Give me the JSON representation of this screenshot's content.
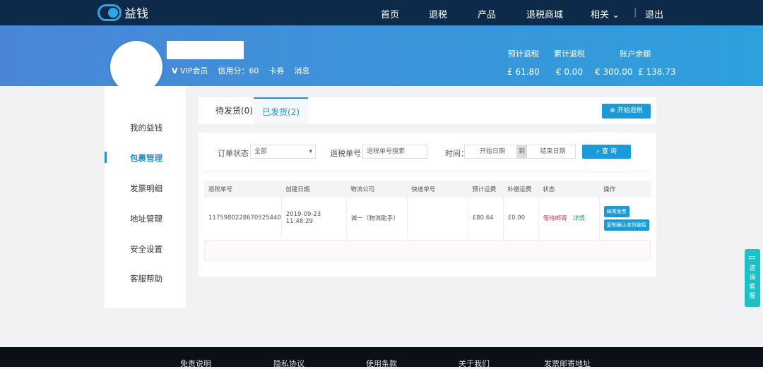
{
  "nav": {
    "brand": "益钱",
    "items": [
      "首页",
      "退税",
      "产品",
      "退税商城",
      "相关"
    ],
    "logout": "退出"
  },
  "profile": {
    "vip": "VIP会员",
    "credit": "信用分：60",
    "coupons": "卡券",
    "messages": "消息"
  },
  "stats": [
    {
      "label": "预计退税",
      "value": "£ 61.80"
    },
    {
      "label": "累计退税",
      "value": "€ 0.00"
    },
    {
      "label": "账户余额",
      "value": "€ 300.00  £ 138.73"
    }
  ],
  "sidebar": [
    "我的益钱",
    "包裹管理",
    "发票明细",
    "地址管理",
    "安全设置",
    "客服帮助"
  ],
  "tabs": [
    "待发货(0)",
    "已发货(2)"
  ],
  "start_button": "⊕ 开始退税",
  "filters": {
    "status_label": "订单状态：",
    "status_value": "全部",
    "order_label": "退税单号：",
    "order_placeholder": "退税单号搜索",
    "time_label": "时间：",
    "start_placeholder": "开始日期",
    "to": "到",
    "end_placeholder": "结束日期",
    "search": "查 询"
  },
  "table": {
    "headers": [
      "退税单号",
      "创建日期",
      "物流公司",
      "快递单号",
      "预计运费",
      "补缴运费",
      "状态",
      "操作"
    ],
    "rows": [
      {
        "id": "1175980228670525440",
        "date": "2019-09-23 11:48:29",
        "carrier": "诚一（物流助手）",
        "tracking": "",
        "est": "£80.64",
        "extra": "£0.00",
        "status": "等待邮寄",
        "detail": "详情",
        "action1": "邮寄发票",
        "action2": "复制确认收货链接"
      }
    ]
  },
  "customer_service": "咨询客服",
  "footer": [
    "免责说明",
    "隐私协议",
    "使用条款",
    "关于我们",
    "发票邮寄地址"
  ]
}
